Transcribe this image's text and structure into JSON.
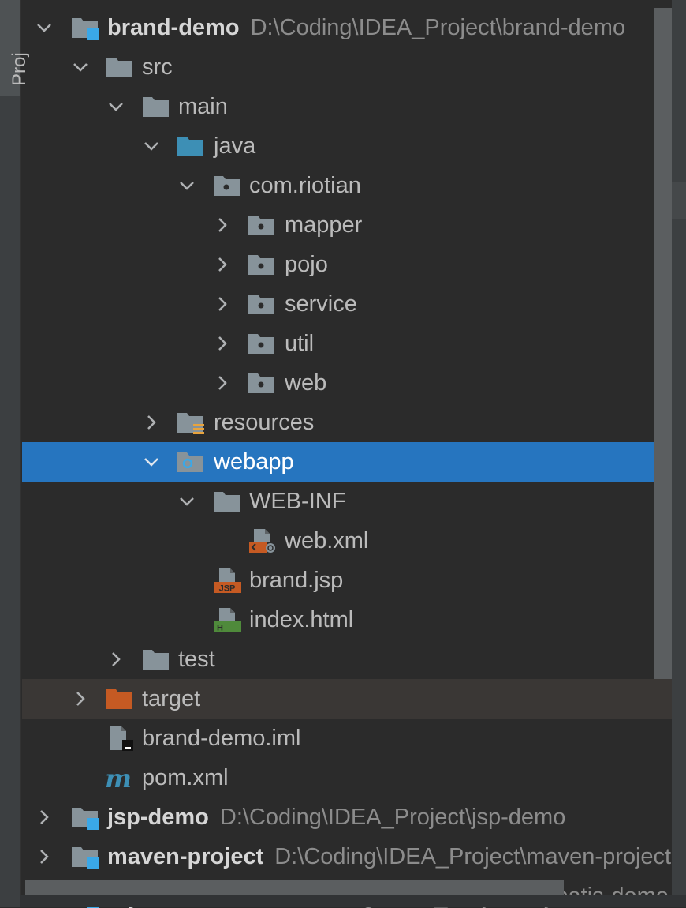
{
  "side_tab": {
    "label": "Proj"
  },
  "tree": {
    "root": {
      "name": "brand-demo",
      "path": "D:\\Coding\\IDEA_Project\\brand-demo"
    },
    "src": "src",
    "main": "main",
    "java": "java",
    "package": "com.riotian",
    "packages": [
      "mapper",
      "pojo",
      "service",
      "util",
      "web"
    ],
    "resources": "resources",
    "webapp": "webapp",
    "web_inf": "WEB-INF",
    "web_xml": "web.xml",
    "brand_jsp": "brand.jsp",
    "index_html": "index.html",
    "test": "test",
    "target": "target",
    "iml": "brand-demo.iml",
    "pom": "pom.xml",
    "other_projects": [
      {
        "name": "jsp-demo",
        "path": "D:\\Coding\\IDEA_Project\\jsp-demo"
      },
      {
        "name": "maven-project",
        "path": "D:\\Coding\\IDEA_Project\\maven-project"
      },
      {
        "name": "mybatis-demo",
        "path": "D:\\Coding\\IDEA_Project\\mybatis-demo"
      }
    ]
  },
  "colors": {
    "background": "#2b2b2b",
    "selection": "#2675bf",
    "folder": "#87939a",
    "source_folder": "#3d8fb5",
    "excluded_folder": "#c55a23",
    "module_badge": "#3aa8e8"
  },
  "icons": {
    "expanded": "chevron-down-icon",
    "collapsed": "chevron-right-icon",
    "module": "module-folder-icon",
    "folder": "folder-icon",
    "source_root": "source-root-folder-icon",
    "package": "package-icon",
    "resources_root": "resources-root-folder-icon",
    "web_root": "web-resource-folder-icon",
    "xml": "xml-file-icon",
    "jsp": "jsp-file-icon",
    "html": "html-file-icon",
    "excluded": "excluded-folder-icon",
    "iml": "iml-file-icon",
    "maven": "maven-pom-icon"
  }
}
